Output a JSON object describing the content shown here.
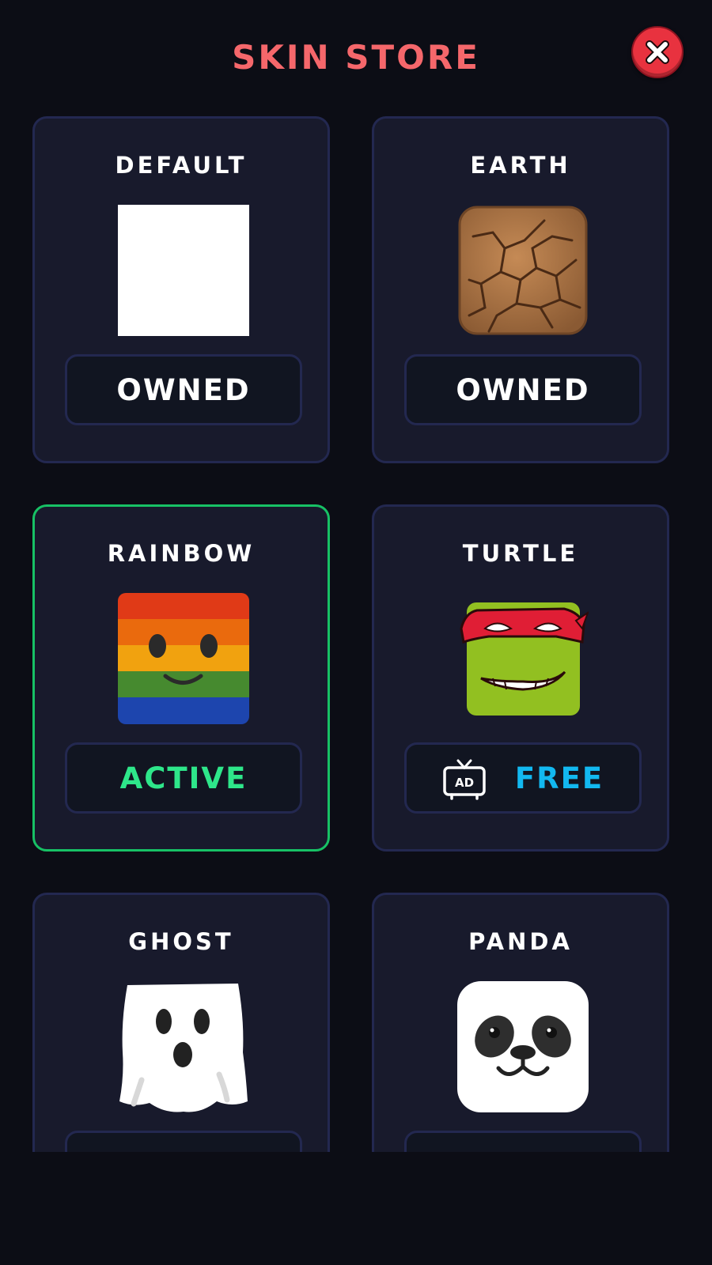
{
  "header": {
    "title": "SKIN STORE",
    "title_color": "#f5676b",
    "close_icon": "close-x-icon"
  },
  "skins": [
    {
      "name": "DEFAULT",
      "preview": "white-square",
      "button": "OWNED",
      "state": "owned"
    },
    {
      "name": "EARTH",
      "preview": "cracked-earth-block",
      "button": "OWNED",
      "state": "owned"
    },
    {
      "name": "RAINBOW",
      "preview": "rainbow-smiley-block",
      "button": "ACTIVE",
      "state": "active"
    },
    {
      "name": "TURTLE",
      "preview": "ninja-turtle-face",
      "button": "FREE",
      "state": "watch-ad",
      "button_icon": "tv-ad-icon"
    },
    {
      "name": "GHOST",
      "preview": "ghost-block",
      "button": "",
      "state": "unknown"
    },
    {
      "name": "PANDA",
      "preview": "panda-face-block",
      "button": "",
      "state": "unknown"
    }
  ],
  "colors": {
    "background": "#0c0d15",
    "card": "#181a2c",
    "card_border": "#232850",
    "active_border": "#17c165",
    "active_text": "#2ee68a",
    "free_text": "#12b8f0",
    "close_button": "#e8323f"
  }
}
